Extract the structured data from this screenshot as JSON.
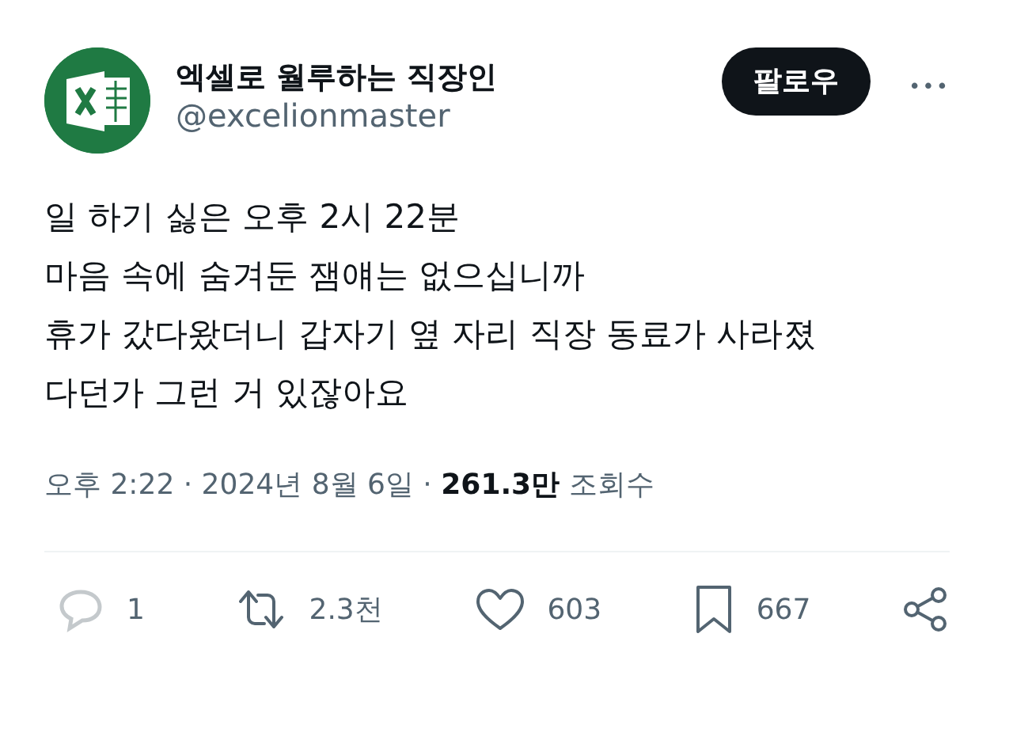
{
  "author": {
    "name": "엑셀로 월루하는 직장인",
    "handle": "@excelionmaster"
  },
  "follow_button": "팔로우",
  "more_button": "•••",
  "body": [
    "일 하기 싫은 오후 2시 22분",
    "마음 속에 숨겨둔 잼얘는 없으십니까",
    "휴가 갔다왔더니 갑자기 옆 자리 직장 동료가 사라졌",
    "다던가 그런 거 있잖아요"
  ],
  "meta": "오후 2:22 · 2024년 8월 6일 · **261.3만** 조회수",
  "actions": [
    {
      "kind": "reply",
      "count": "1"
    },
    {
      "kind": "repost",
      "count": "2.3천"
    },
    {
      "kind": "like",
      "count": "603"
    },
    {
      "kind": "bookmark",
      "count": "667"
    },
    {
      "kind": "share"
    }
  ]
}
